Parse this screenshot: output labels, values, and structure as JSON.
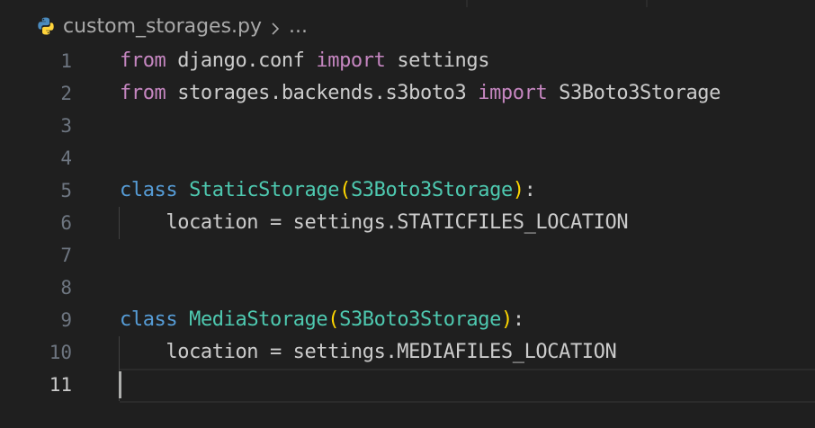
{
  "breadcrumb": {
    "file_icon": "python-icon",
    "file_name": "custom_storages.py",
    "separator_icon": "chevron-right-icon",
    "more": "..."
  },
  "colors": {
    "background": "#1f1f1f",
    "keyword_import": "#c586c0",
    "keyword_class": "#569cd6",
    "class_name": "#4ec9b0",
    "bracket": "#ffd700",
    "text": "#cccccc",
    "line_number": "#6e7681"
  },
  "editor": {
    "current_line": 11,
    "lines": [
      {
        "number": "1",
        "tokens": [
          {
            "text": "from",
            "type": "kw-import"
          },
          {
            "text": " django.conf ",
            "type": "plain"
          },
          {
            "text": "import",
            "type": "kw-import"
          },
          {
            "text": " settings",
            "type": "plain"
          }
        ]
      },
      {
        "number": "2",
        "tokens": [
          {
            "text": "from",
            "type": "kw-import"
          },
          {
            "text": " storages.backends.s3boto3 ",
            "type": "plain"
          },
          {
            "text": "import",
            "type": "kw-import"
          },
          {
            "text": " S3Boto3Storage",
            "type": "plain"
          }
        ]
      },
      {
        "number": "3",
        "tokens": []
      },
      {
        "number": "4",
        "tokens": []
      },
      {
        "number": "5",
        "tokens": [
          {
            "text": "class",
            "type": "kw-def"
          },
          {
            "text": " ",
            "type": "plain"
          },
          {
            "text": "StaticStorage",
            "type": "cls"
          },
          {
            "text": "(",
            "type": "paren"
          },
          {
            "text": "S3Boto3Storage",
            "type": "cls"
          },
          {
            "text": ")",
            "type": "paren"
          },
          {
            "text": ":",
            "type": "plain"
          }
        ]
      },
      {
        "number": "6",
        "indent": true,
        "tokens": [
          {
            "text": "    location = settings.STATICFILES_LOCATION",
            "type": "plain"
          }
        ]
      },
      {
        "number": "7",
        "tokens": []
      },
      {
        "number": "8",
        "tokens": []
      },
      {
        "number": "9",
        "tokens": [
          {
            "text": "class",
            "type": "kw-def"
          },
          {
            "text": " ",
            "type": "plain"
          },
          {
            "text": "MediaStorage",
            "type": "cls"
          },
          {
            "text": "(",
            "type": "paren"
          },
          {
            "text": "S3Boto3Storage",
            "type": "cls"
          },
          {
            "text": ")",
            "type": "paren"
          },
          {
            "text": ":",
            "type": "plain"
          }
        ]
      },
      {
        "number": "10",
        "indent": true,
        "tokens": [
          {
            "text": "    location = settings.MEDIAFILES_LOCATION",
            "type": "plain"
          }
        ]
      },
      {
        "number": "11",
        "indent": true,
        "current": true,
        "tokens": []
      }
    ]
  }
}
